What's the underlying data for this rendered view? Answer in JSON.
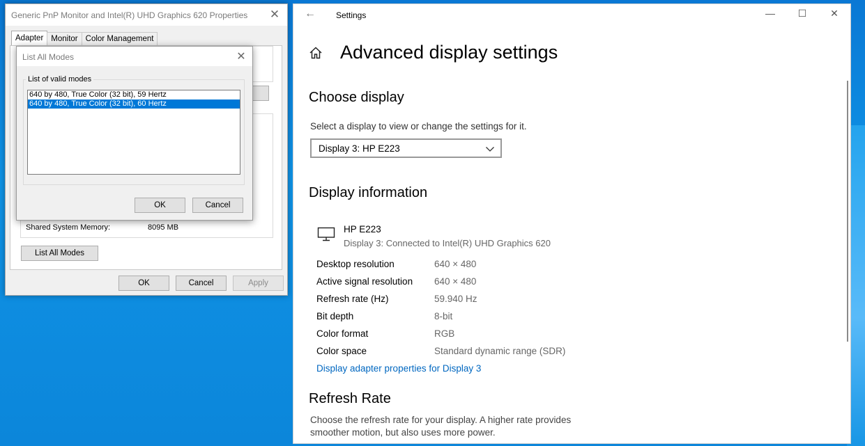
{
  "properties_window": {
    "title": "Generic PnP Monitor and Intel(R) UHD Graphics 620 Properties",
    "tabs": [
      {
        "label": "Adapter",
        "active": true
      },
      {
        "label": "Monitor",
        "active": false
      },
      {
        "label": "Color Management",
        "active": false
      }
    ],
    "shared_memory_label": "Shared System Memory:",
    "shared_memory_value": "8095 MB",
    "list_all_modes_label": "List All Modes",
    "ok_label": "OK",
    "cancel_label": "Cancel",
    "apply_label": "Apply"
  },
  "modes_dialog": {
    "title": "List All Modes",
    "group_label": "List of valid modes",
    "modes": [
      {
        "label": "640 by 480, True Color (32 bit), 59 Hertz",
        "selected": false
      },
      {
        "label": "640 by 480, True Color (32 bit), 60 Hertz",
        "selected": true
      }
    ],
    "ok_label": "OK",
    "cancel_label": "Cancel"
  },
  "settings": {
    "window_title": "Settings",
    "page_title": "Advanced display settings",
    "choose_display_heading": "Choose display",
    "choose_display_text": "Select a display to view or change the settings for it.",
    "selected_display": "Display 3: HP E223",
    "display_info_heading": "Display information",
    "monitor_name": "HP E223",
    "monitor_connection": "Display 3: Connected to Intel(R) UHD Graphics 620",
    "info": [
      {
        "label": "Desktop resolution",
        "value": "640 × 480"
      },
      {
        "label": "Active signal resolution",
        "value": "640 × 480"
      },
      {
        "label": "Refresh rate (Hz)",
        "value": "59.940 Hz"
      },
      {
        "label": "Bit depth",
        "value": "8-bit"
      },
      {
        "label": "Color format",
        "value": "RGB"
      },
      {
        "label": "Color space",
        "value": "Standard dynamic range (SDR)"
      }
    ],
    "adapter_link": "Display adapter properties for Display 3",
    "refresh_heading": "Refresh Rate",
    "refresh_text_1": "Choose the refresh rate for your display. A higher rate provides",
    "refresh_text_2": "smoother motion, but also uses more power."
  },
  "colors": {
    "accent": "#0078d7",
    "link": "#0067c0",
    "desktop": "#0a8fdc"
  }
}
